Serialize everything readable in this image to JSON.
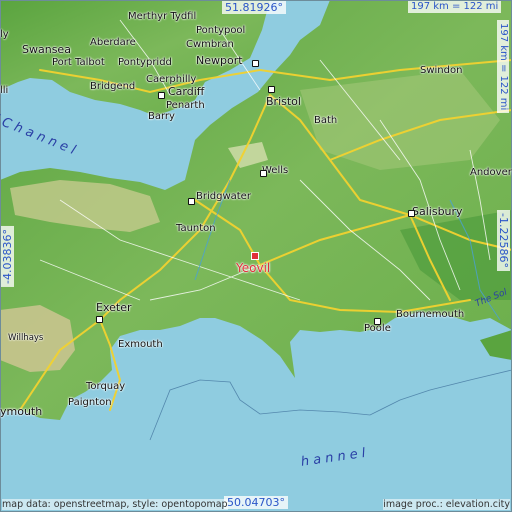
{
  "map": {
    "place": "Yeovil",
    "colors": {
      "sea": "#8fcce0",
      "land_low": "#4e9e3a",
      "land_mid": "#7bb859",
      "land_high": "#c9cf8e",
      "road_major": "#f2d230",
      "road_minor": "#ffffff",
      "marker": "#e0303a",
      "coord_text": "#2a55c8"
    }
  },
  "coords": {
    "top": "51.81926°",
    "bottom": "50.04703°",
    "left": "-4.03836°",
    "right": "-1.22586°",
    "scale_top": "197 km = 122 mi",
    "scale_right": "197 km = 122 mi"
  },
  "credits": {
    "left": "map data: openstreetmap, style: opentopomap",
    "right": "image proc.: elevation.city"
  },
  "labels": {
    "merthyr": "Merthyr Tydfil",
    "pontypool": "Pontypool",
    "aberdare": "Aberdare",
    "cwmbran": "Cwmbran",
    "swansea": "Swansea",
    "port_talbot": "Port Talbot",
    "pontypridd": "Pontypridd",
    "newport": "Newport",
    "caerphilly": "Caerphilly",
    "bridgend": "Bridgend",
    "cardiff": "Cardiff",
    "penarth": "Penarth",
    "barry": "Barry",
    "bristol": "Bristol",
    "bath": "Bath",
    "swindon": "Swindon",
    "wells": "Wells",
    "andover": "Andover",
    "bridgwater": "Bridgwater",
    "salisbury": "Salisbury",
    "taunton": "Taunton",
    "exeter": "Exeter",
    "exmouth": "Exmouth",
    "poole": "Poole",
    "bournemouth": "Bournemouth",
    "torquay": "Torquay",
    "paignton": "Paignton",
    "plymouth": "ymouth",
    "willhays": "Willhays",
    "the_solent": "The Sol",
    "channel_upper": "l  C h a n n e l",
    "channel_lower": "h a n n e l",
    "left_edge_1": "ly",
    "left_edge_2": "lli"
  }
}
